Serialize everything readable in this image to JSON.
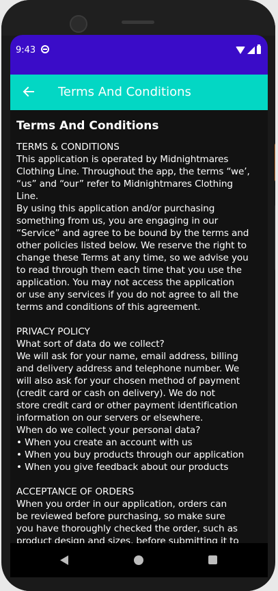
{
  "status_bar": {
    "time": "9:43",
    "icons": [
      "do-not-disturb-icon",
      "wifi-icon",
      "signal-icon",
      "battery-icon"
    ]
  },
  "app_bar": {
    "title": "Terms And Conditions",
    "back_icon": "arrow-left-icon",
    "color": "#03d7c4"
  },
  "status_bar_color": "#3a0cc8",
  "content": {
    "heading": "Terms And Conditions",
    "lines": [
      "TERMS & CONDITIONS",
      "This application is operated by Midnightmares",
      "Clothing Line. Throughout the app, the terms “we’,",
      "“us” and “our” refer to Midnightmares Clothing",
      "Line.",
      "By using this application and/or purchasing",
      "something from us, you are engaging in our",
      "“Service” and agree to be bound by the terms and",
      "other policies listed below. We reserve the right to",
      "change these Terms at any time, so we advise you",
      "to read through them each time that you use the",
      "application. You may not access the application",
      "or use any services if you do not agree to all the",
      "terms and conditions of this agreement.",
      "",
      "PRIVACY POLICY",
      "What sort of data do we collect?",
      "We will ask for your name, email address, billing",
      "and delivery address and telephone number. We",
      "will also ask for your chosen method of payment",
      "(credit card or cash on delivery). We do not",
      "store credit card or other payment identification",
      "information on our servers or elsewhere.",
      "When do we collect your personal data?",
      "• When you create an account with us",
      "• When you buy products through our application",
      "• When you give feedback about our products",
      "",
      "ACCEPTANCE OF ORDERS",
      "When you order in our application, orders can",
      "be reviewed before purchasing, so make sure",
      "you have thoroughly checked the order, such as",
      "product design and sizes, before submitting it to"
    ]
  },
  "nav_bar": {
    "icons": [
      "nav-back-icon",
      "nav-home-icon",
      "nav-recents-icon"
    ]
  }
}
